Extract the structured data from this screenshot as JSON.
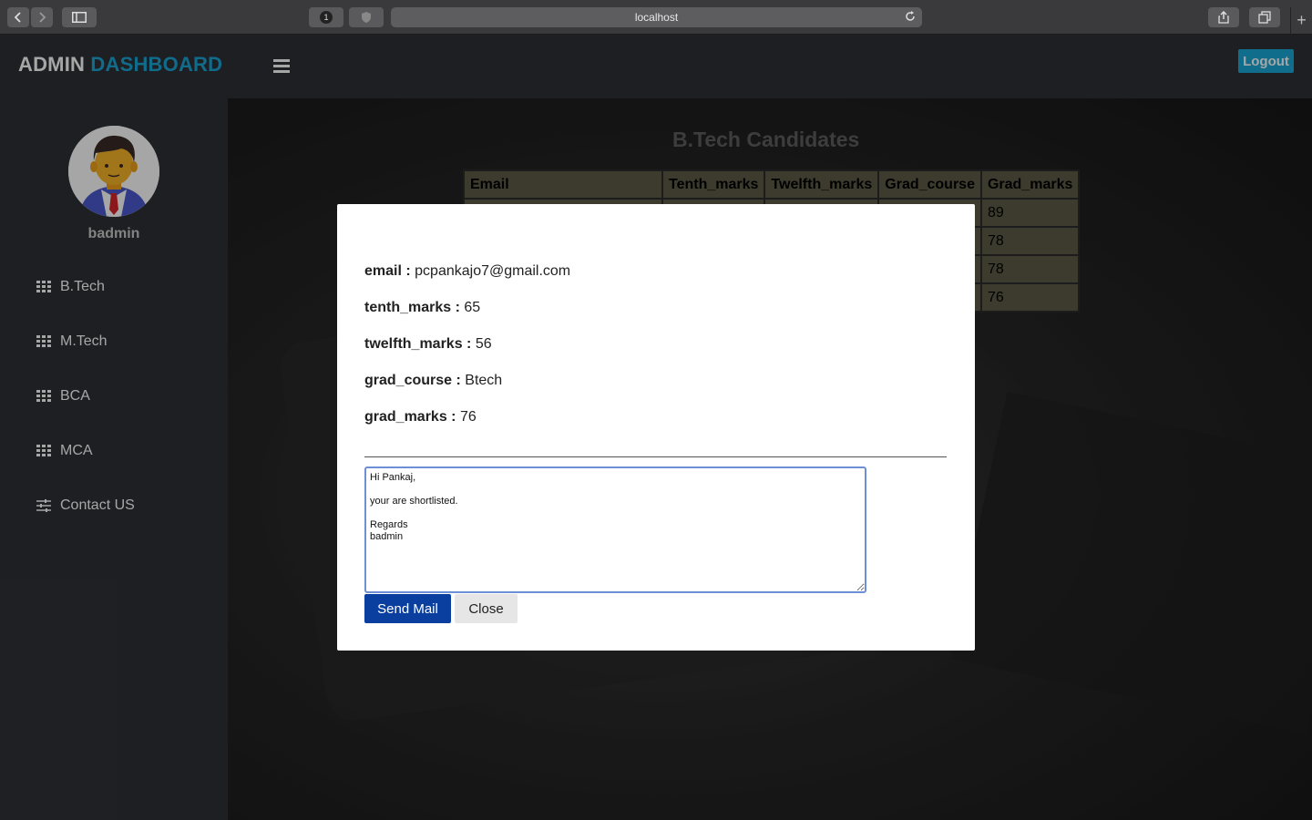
{
  "browser": {
    "url": "localhost",
    "tab_badge": "1"
  },
  "header": {
    "brand_part1": "ADMIN",
    "brand_part2": "DASHBOARD",
    "logout_label": "Logout"
  },
  "sidebar": {
    "username": "badmin",
    "items": [
      {
        "label": "B.Tech",
        "icon": "grid-icon"
      },
      {
        "label": "M.Tech",
        "icon": "grid-icon"
      },
      {
        "label": "BCA",
        "icon": "grid-icon"
      },
      {
        "label": "MCA",
        "icon": "grid-icon"
      },
      {
        "label": "Contact US",
        "icon": "sliders-icon"
      }
    ]
  },
  "main": {
    "title": "B.Tech Candidates",
    "table": {
      "columns": [
        "Email",
        "Tenth_marks",
        "Twelfth_marks",
        "Grad_course",
        "Grad_marks"
      ],
      "visible_grad_marks": [
        "89",
        "78",
        "78",
        "76"
      ]
    }
  },
  "modal": {
    "fields": [
      {
        "key": "email :",
        "value": "pcpankajo7@gmail.com"
      },
      {
        "key": "tenth_marks :",
        "value": "65"
      },
      {
        "key": "twelfth_marks :",
        "value": "56"
      },
      {
        "key": "grad_course :",
        "value": "Btech"
      },
      {
        "key": "grad_marks :",
        "value": "76"
      }
    ],
    "message": "Hi Pankaj,\n\nyour are shortlisted.\n\nRegards\nbadmin",
    "send_label": "Send Mail",
    "close_label": "Close"
  },
  "colors": {
    "brand_accent": "#1ba5d4",
    "send_button": "#0a3f9f",
    "sidebar_bg": "#2e3137",
    "table_bg": "#5c5b47"
  }
}
